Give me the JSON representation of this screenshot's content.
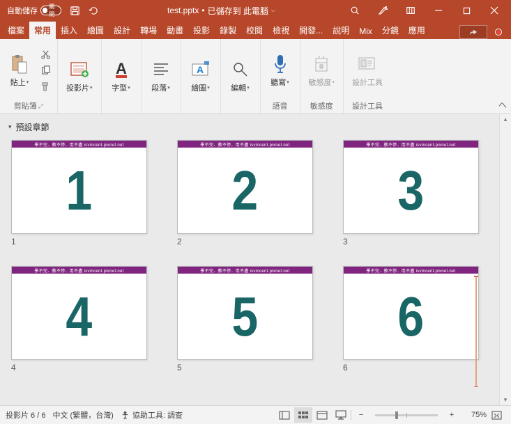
{
  "titlebar": {
    "autosave_label": "自動儲存",
    "autosave_state": "關閉",
    "filename": "test.pptx",
    "saved_to": "已儲存到 此電腦"
  },
  "tabs": {
    "file": "檔案",
    "home": "常用",
    "insert": "插入",
    "draw": "繪圖",
    "design": "設計",
    "transitions": "轉場",
    "animations": "動畫",
    "slideshow": "投影",
    "record": "錄製",
    "review": "校閱",
    "view": "檢視",
    "developer": "開發...",
    "help": "說明",
    "mix": "Mix",
    "split": "分鏡",
    "apply": "應用"
  },
  "ribbon": {
    "paste": "貼上",
    "clipboard_group": "剪貼簿",
    "slide": "投影片",
    "font": "字型",
    "paragraph": "段落",
    "drawing": "繪圖",
    "editing": "編輯",
    "dictate": "聽寫",
    "voice_group": "語音",
    "sensitivity": "敏感度",
    "sensitivity_group": "敏感度",
    "designer": "設計工具",
    "designer_group": "設計工具"
  },
  "section": {
    "default": "預設章節"
  },
  "slides": [
    {
      "n": "1",
      "label": "1"
    },
    {
      "n": "2",
      "label": "2"
    },
    {
      "n": "3",
      "label": "3"
    },
    {
      "n": "4",
      "label": "4"
    },
    {
      "n": "5",
      "label": "5"
    },
    {
      "n": "6",
      "label": "6"
    }
  ],
  "thumb_banner_text": "學不完．教不停．用不盡 isvincent.pixnet.net",
  "statusbar": {
    "slide_counter": "投影片 6 / 6",
    "language": "中文 (繁體，台灣)",
    "accessibility": "協助工具: 調查",
    "zoom": "75%"
  },
  "colors": {
    "brand": "#b7472a",
    "banner": "#80257f",
    "number": "#1a6666"
  }
}
